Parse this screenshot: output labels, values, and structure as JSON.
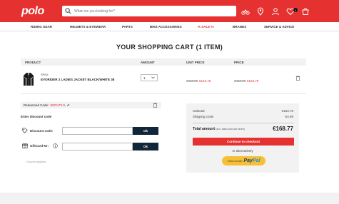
{
  "header": {
    "logo": "polo",
    "search_placeholder": "What are you looking for?",
    "icons": [
      "motorcycle-icon",
      "location-icon",
      "user-icon",
      "heart-icon",
      "cart-icon"
    ],
    "cart_count": "1",
    "accent_color": "#e63131"
  },
  "nav": {
    "items": [
      "RIDING GEAR",
      "HELMETS & EYEWEAR",
      "PARTS",
      "BIKE ACCESSORIES",
      "% SALE %",
      "BRANDS",
      "SERVICE & ADVICE"
    ]
  },
  "cart": {
    "title": "YOUR SHOPPING CART (1 ITEM)",
    "columns": [
      "PRODUCT",
      "AMOUNT",
      "UNIT PRICE",
      "PRICE"
    ],
    "item": {
      "brand": "SPIDI",
      "name": "EVORIDER 2 LADIES JACKET BLACK/WHITE 38",
      "quantity": "1",
      "unit_price_old": "€418.99",
      "unit_price_new": "€163.78",
      "price_old": "€418.99",
      "price_new": "€163.78"
    }
  },
  "voucher": {
    "redeemed_label": "Redeemed Code:",
    "redeemed_code": "SERVT1%",
    "enter_label": "Enter discount code",
    "discount_label": "Discount code:",
    "giftcard_label": "GiftCard-Nr:",
    "ok_label": "Ok",
    "coupon_label": "Coupon applied"
  },
  "summary": {
    "subtotal_label": "Subtotal",
    "subtotal_value": "€163.78",
    "shipping_label": "Shipping costs",
    "shipping_value": "€4.99",
    "total_label": "Total amount",
    "total_note": "(incl. sales and use taxes)",
    "total_value": "€168.77",
    "checkout_label": "Continue to checkout",
    "or_alt": "or alternatively",
    "paypal_pre": "Check out with",
    "paypal_1": "Pay",
    "paypal_2": "Pal"
  }
}
